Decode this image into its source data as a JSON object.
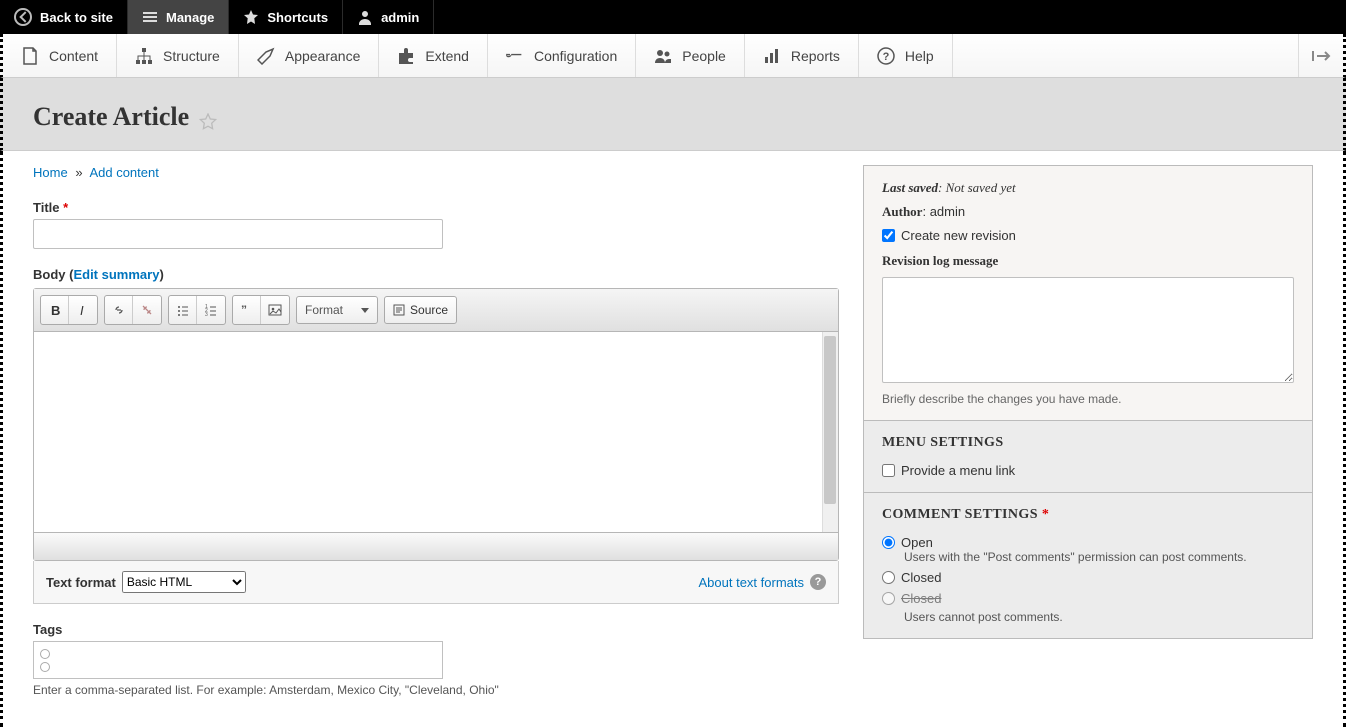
{
  "toolbar": {
    "back": "Back to site",
    "manage": "Manage",
    "shortcuts": "Shortcuts",
    "user": "admin"
  },
  "admin_menu": {
    "content": "Content",
    "structure": "Structure",
    "appearance": "Appearance",
    "extend": "Extend",
    "configuration": "Configuration",
    "people": "People",
    "reports": "Reports",
    "help": "Help"
  },
  "page": {
    "title": "Create Article"
  },
  "breadcrumb": {
    "home": "Home",
    "sep": "»",
    "add": "Add content"
  },
  "form": {
    "title_label": "Title",
    "body_label": "Body",
    "edit_summary": "Edit summary",
    "format_btn": "Format",
    "source_btn": "Source",
    "text_format_label": "Text format",
    "text_format_value": "Basic HTML",
    "about_formats": "About text formats",
    "tags_label": "Tags",
    "tags_hint": "Enter a comma-separated list. For example: Amsterdam, Mexico City, \"Cleveland, Ohio\""
  },
  "sidebar": {
    "last_saved_label": "Last saved",
    "last_saved_value": "Not saved yet",
    "author_label": "Author",
    "author_value": "admin",
    "create_revision": "Create new revision",
    "revlog_label": "Revision log message",
    "revlog_hint": "Briefly describe the changes you have made.",
    "menu_settings_title": "MENU SETTINGS",
    "provide_menu_link": "Provide a menu link",
    "comment_settings_title": "COMMENT SETTINGS",
    "open_label": "Open",
    "open_desc": "Users with the \"Post comments\" permission can post comments.",
    "closed_label": "Closed",
    "closed_label2": "Closed",
    "closed_desc": "Users cannot post comments."
  }
}
